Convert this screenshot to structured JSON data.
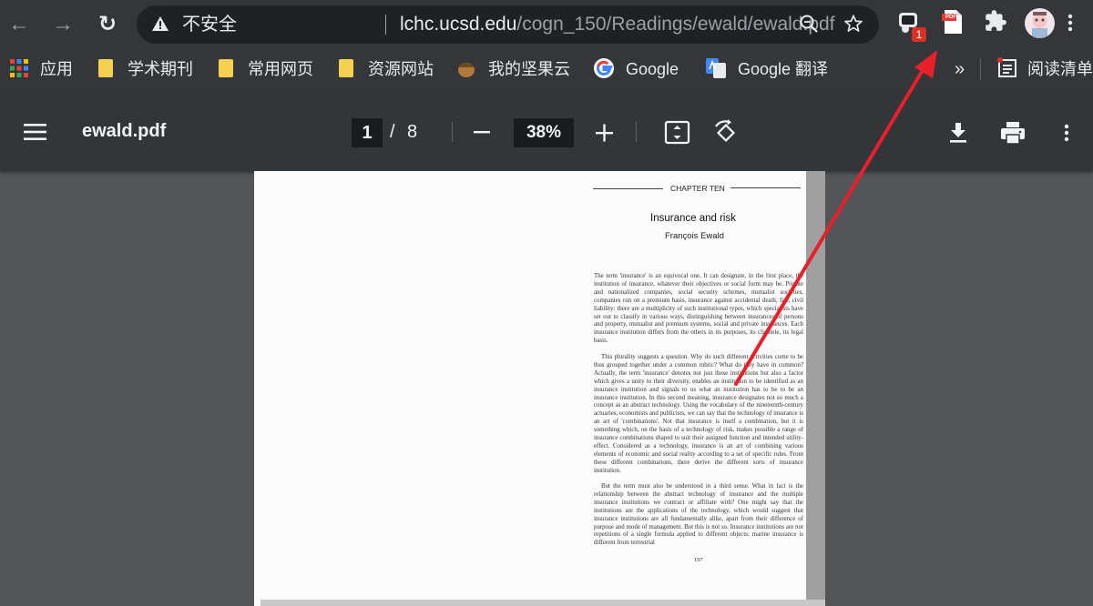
{
  "browser": {
    "nav": {
      "back_glyph": "←",
      "forward_glyph": "→",
      "reload_glyph": "↻"
    },
    "omnibox": {
      "security_text": "不安全",
      "url_host": "lchc.ucsd.edu",
      "url_path": "/cogn_150/Readings/ewald/ewald.pdf"
    },
    "extensions": {
      "badge_count": "1",
      "pdf_icon_text": "PDF"
    },
    "bookmarks": [
      {
        "label": "应用",
        "icon": "apps-grid-icon"
      },
      {
        "label": "学术期刊",
        "icon": "folder-icon"
      },
      {
        "label": "常用网页",
        "icon": "folder-icon"
      },
      {
        "label": "资源网站",
        "icon": "folder-icon"
      },
      {
        "label": "我的坚果云",
        "icon": "nut-icon"
      },
      {
        "label": "Google",
        "icon": "google-icon"
      },
      {
        "label": "Google 翻译",
        "icon": "google-translate-icon"
      }
    ],
    "bookmarks_overflow": "»",
    "reading_list": "阅读清单"
  },
  "viewer": {
    "filename": "ewald.pdf",
    "current_page": "1",
    "page_separator": "/",
    "total_pages": "8",
    "zoom": "38%"
  },
  "document": {
    "chapter": "CHAPTER TEN",
    "title": "Insurance and risk",
    "author": "François Ewald",
    "paragraph1": "The term 'insurance' is an equivocal one. It can designate, in the first place, the institution of insurance, whatever their objectives or social form may be. Private and nationalized companies, social security schemes, mutualist societies, companies run on a premium basis, insurance against accidental death, fire, civil liability: there are a multiplicity of such institutional types, which specialists have set out to classify in various ways, distinguishing between insurances of persons and property, mutualist and premium systems, social and private insurances. Each insurance institution differs from the others in its purposes, its clientele, its legal basis.",
    "paragraph2": "This plurality suggests a question. Why do such different activities come to be thus grouped together under a common rubric? What do they have in common? Actually, the term 'insurance' denotes not just these institutions but also a factor which gives a unity to their diversity, enables an institution to be identified as an insurance institution and signals to us what an institution has to be to be an insurance institution. In this second meaning, insurance designates not so much a concept as an abstract technology. Using the vocabulary of the nineteenth-century actuaries, economists and publicists, we can say that the technology of insurance is an art of 'combinations'. Not that insurance is itself a combination, but it is something which, on the basis of a technology of risk, makes possible a range of insurance combinations shaped to suit their assigned function and intended utility-effect. Considered as a technology, insurance is an art of combining various elements of economic and social reality according to a set of specific rules. From these different combinations, there derive the different sorts of insurance institution.",
    "paragraph3": "But the term must also be understood in a third sense. What in fact is the relationship between the abstract technology of insurance and the multiple insurance institutions we contract or affiliate with? One might say that the institutions are the applications of the technology, which would suggest that insurance institutions are all fundamentally alike, apart from their difference of purpose and mode of management. But this is not so. Insurance institutions are not repetitions of a single formula applied to different objects: marine insurance is different from terrestrial",
    "page_number": "197"
  },
  "colors": {
    "annotation_arrow": "#e8202a",
    "badge": "#d93025",
    "toolbar": "#323639",
    "chrome": "#35363a"
  }
}
